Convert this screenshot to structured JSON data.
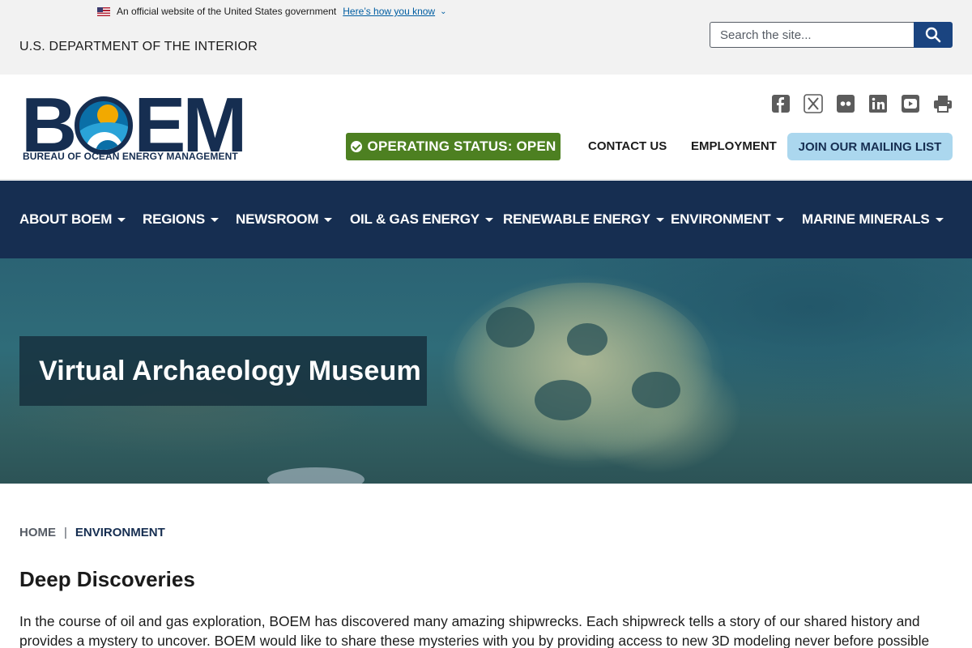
{
  "gov_banner": {
    "text": "An official website of the United States government",
    "link": "Here’s how you know"
  },
  "department": "U.S. DEPARTMENT OF THE INTERIOR",
  "search": {
    "placeholder": "Search the site..."
  },
  "logo": {
    "main": "BOEM",
    "subtitle": "BUREAU OF OCEAN ENERGY MANAGEMENT"
  },
  "social_icons": [
    "facebook-icon",
    "x-icon",
    "flickr-icon",
    "linkedin-icon",
    "youtube-icon",
    "print-icon"
  ],
  "header": {
    "status": "OPERATING STATUS: OPEN",
    "contact": "CONTACT US",
    "employment": "EMPLOYMENT",
    "mailing": "JOIN OUR MAILING LIST"
  },
  "nav": [
    "ABOUT BOEM",
    "REGIONS",
    "NEWSROOM",
    "OIL & GAS ENERGY",
    "RENEWABLE ENERGY",
    "ENVIRONMENT",
    "MARINE MINERALS"
  ],
  "hero": {
    "title": "Virtual Archaeology Museum"
  },
  "breadcrumb": {
    "home": "HOME",
    "separator": "|",
    "current": "ENVIRONMENT"
  },
  "content": {
    "heading": "Deep Discoveries",
    "paragraph": "In the course of oil and gas exploration, BOEM has discovered many amazing shipwrecks. Each shipwreck tells a story of our shared history and provides a mystery to uncover. BOEM would like to share these mysteries with you by providing access to new 3D modeling never before possible using video publicly"
  },
  "colors": {
    "navy": "#162e51",
    "status_green": "#4d8021",
    "mailing_blue": "#abd7ee",
    "search_button": "#1a4480",
    "link_blue": "#005ea2"
  }
}
